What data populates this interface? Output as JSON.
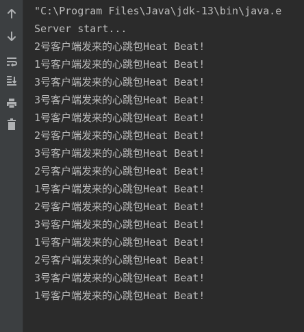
{
  "toolbar": {
    "buttons": [
      {
        "icon": "arrow-up-icon"
      },
      {
        "icon": "arrow-down-icon"
      },
      {
        "icon": "soft-wrap-icon"
      },
      {
        "icon": "scroll-to-end-icon"
      },
      {
        "icon": "print-icon"
      },
      {
        "icon": "trash-icon"
      }
    ],
    "icon_color": "#afb1b3"
  },
  "console": {
    "command_line": "\"C:\\Program Files\\Java\\jdk-13\\bin\\java.e",
    "output_lines": [
      "Server start...",
      "2号客户端发来的心跳包Heat Beat!",
      "1号客户端发来的心跳包Heat Beat!",
      "3号客户端发来的心跳包Heat Beat!",
      "3号客户端发来的心跳包Heat Beat!",
      "1号客户端发来的心跳包Heat Beat!",
      "2号客户端发来的心跳包Heat Beat!",
      "3号客户端发来的心跳包Heat Beat!",
      "2号客户端发来的心跳包Heat Beat!",
      "1号客户端发来的心跳包Heat Beat!",
      "2号客户端发来的心跳包Heat Beat!",
      "3号客户端发来的心跳包Heat Beat!",
      "1号客户端发来的心跳包Heat Beat!",
      "2号客户端发来的心跳包Heat Beat!",
      "3号客户端发来的心跳包Heat Beat!",
      "1号客户端发来的心跳包Heat Beat!"
    ],
    "text_color": "#bbbbbb",
    "background": "#2b2b2b"
  }
}
